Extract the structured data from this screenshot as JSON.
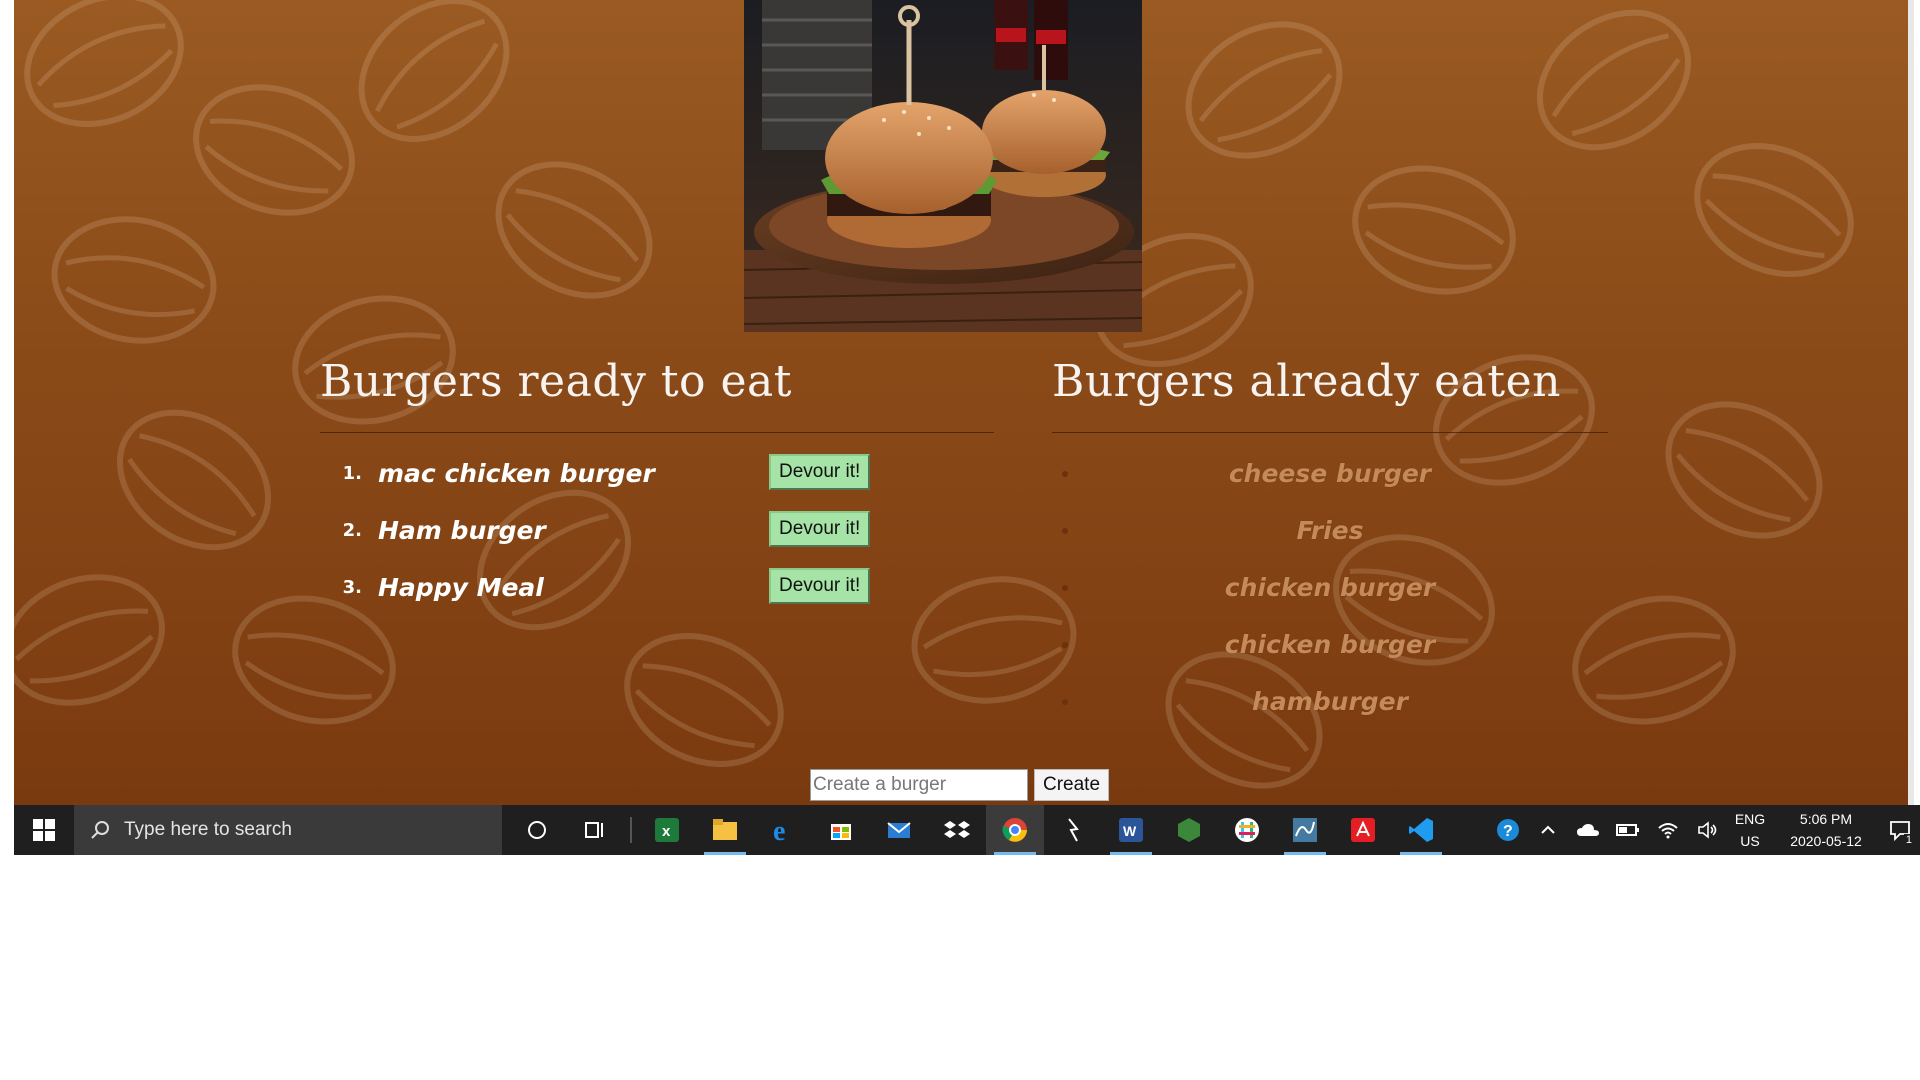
{
  "page": {
    "hero_alt": "Two burgers on a wooden board",
    "accent": "#8a4a18"
  },
  "ready": {
    "title": "Burgers ready to eat",
    "button_label": "Devour it!",
    "items": [
      {
        "num": "1.",
        "name": "mac chicken burger"
      },
      {
        "num": "2.",
        "name": "Ham burger"
      },
      {
        "num": "3.",
        "name": "Happy Meal"
      }
    ]
  },
  "eaten": {
    "title": "Burgers already eaten",
    "items": [
      "cheese burger",
      "Fries",
      "chicken burger",
      "chicken burger",
      "hamburger"
    ]
  },
  "create": {
    "placeholder": "Create a burger",
    "button_label": "Create"
  },
  "taskbar": {
    "search_placeholder": "Type here to search",
    "icons": [
      "task-view-cortana-icon",
      "task-view-icon",
      "excel-icon",
      "file-explorer-icon",
      "edge-icon",
      "store-icon",
      "mail-icon",
      "dropbox-icon",
      "chrome-icon",
      "terminal-icon",
      "word-icon",
      "node-icon",
      "slack-icon",
      "mysql-workbench-icon",
      "acrobat-icon",
      "vscode-icon"
    ],
    "tray": {
      "lang_top": "ENG",
      "lang_bottom": "US",
      "time": "5:06 PM",
      "date": "2020-05-12",
      "notification_count": "1"
    }
  }
}
